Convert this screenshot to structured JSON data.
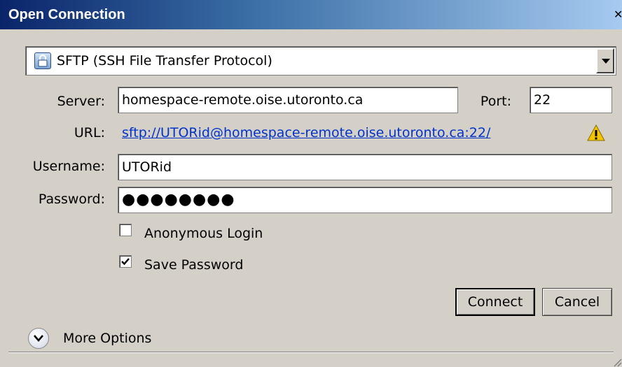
{
  "window": {
    "title": "Open Connection"
  },
  "protocol": {
    "selected": "SFTP (SSH File Transfer Protocol)"
  },
  "server": {
    "label": "Server:",
    "value": "homespace-remote.oise.utoronto.ca"
  },
  "port": {
    "label": "Port:",
    "value": "22"
  },
  "url": {
    "label": "URL:",
    "value": "sftp://UTORid@homespace-remote.oise.utoronto.ca:22/"
  },
  "username": {
    "label": "Username:",
    "value": "UTORid"
  },
  "password": {
    "label": "Password:",
    "value": "●●●●●●●●"
  },
  "anonymous": {
    "label": "Anonymous Login",
    "checked": false
  },
  "save_password": {
    "label": "Save Password",
    "checked": true
  },
  "buttons": {
    "connect": "Connect",
    "cancel": "Cancel"
  },
  "more_options": {
    "label": "More Options"
  },
  "icons": {
    "protocol": "lock-icon",
    "warning": "warning-icon",
    "expand": "chevron-down-icon"
  }
}
